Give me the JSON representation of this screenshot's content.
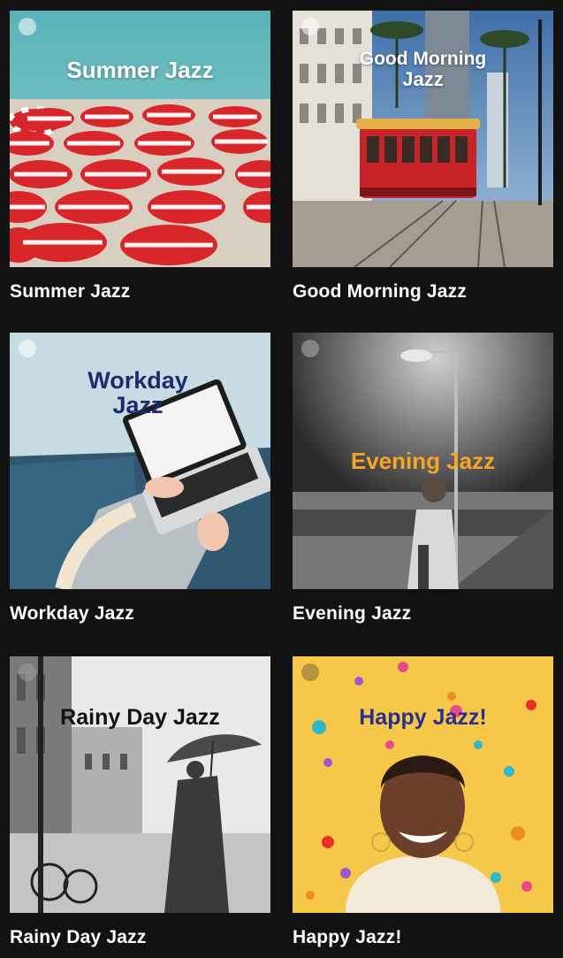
{
  "playlists": [
    {
      "id": "summer",
      "cover_title": "Summer Jazz",
      "caption": "Summer Jazz",
      "title_color": "#ffffff"
    },
    {
      "id": "morning",
      "cover_title_line1": "Good Morning",
      "cover_title_line2": "Jazz",
      "caption": "Good Morning Jazz",
      "title_color": "#ffffff"
    },
    {
      "id": "workday",
      "cover_title_line1": "Workday",
      "cover_title_line2": "Jazz",
      "caption": "Workday Jazz",
      "title_color": "#1c2a6e"
    },
    {
      "id": "evening",
      "cover_title": "Evening Jazz",
      "caption": "Evening Jazz",
      "title_color": "#f5a623"
    },
    {
      "id": "rainy",
      "cover_title": "Rainy Day Jazz",
      "caption": "Rainy Day Jazz",
      "title_color": "#111111"
    },
    {
      "id": "happy",
      "cover_title": "Happy Jazz!",
      "caption": "Happy Jazz!",
      "title_color": "#2a2f8f"
    }
  ],
  "icons": {
    "cover_badge": "spotify-icon"
  }
}
